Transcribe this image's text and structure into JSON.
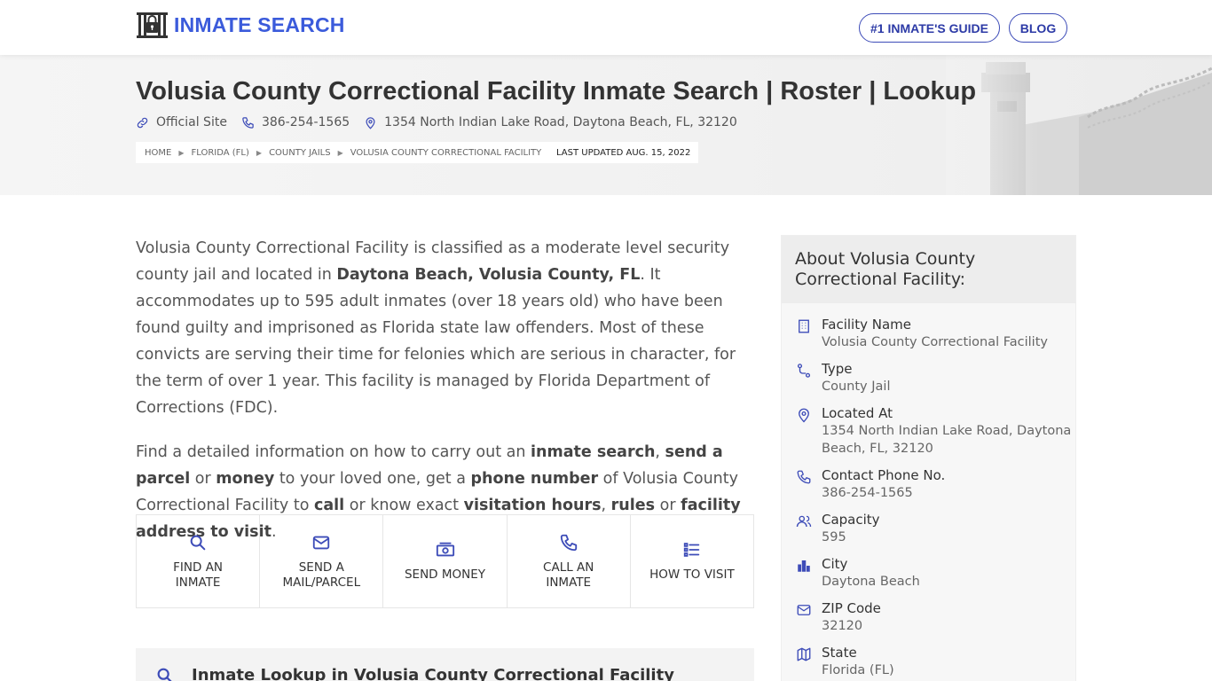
{
  "brand": {
    "name": "INMATE SEARCH",
    "logo_icon": "jail-cell-lock-icon",
    "color": "#3b5bdb"
  },
  "nav": {
    "guide_label": "#1 INMATE'S GUIDE",
    "blog_label": "BLOG"
  },
  "hero": {
    "title": "Volusia County Correctional Facility Inmate Search | Roster | Lookup",
    "official_site": "Official Site",
    "phone": "386-254-1565",
    "address": "1354 North Indian Lake Road, Daytona Beach, FL, 32120",
    "breadcrumbs": [
      "HOME",
      "FLORIDA (FL)",
      "COUNTY JAILS",
      "VOLUSIA COUNTY CORRECTIONAL FACILITY"
    ],
    "last_updated": "LAST UPDATED AUG. 15, 2022"
  },
  "intro": {
    "p1": {
      "t1": "Volusia County Correctional Facility is classified as a moderate level security county jail and located in ",
      "b1": "Daytona Beach, Volusia County, FL",
      "t2": ". It accommodates up to 595 adult inmates (over 18 years old) who have been found guilty and imprisoned as Florida state law offenders. Most of these convicts are serving their time for felonies which are serious in character, for the term of over 1 year. This facility is managed by Florida Department of Corrections (FDC)."
    },
    "p2": {
      "t1": "Find a detailed information on how to carry out an ",
      "b1": "inmate search",
      "t2": ", ",
      "b2": "send a parcel",
      "t3": " or ",
      "b3": "money",
      "t4": " to your loved one, get a ",
      "b4": "phone number",
      "t5": " of Volusia County Correctional Facility to ",
      "b5": "call",
      "t6": " or know exact ",
      "b6": "visitation hours",
      "t7": ", ",
      "b7": "rules",
      "t8": " or ",
      "b8": "facility address to visit",
      "t9": "."
    }
  },
  "actions": [
    {
      "label": "FIND AN INMATE",
      "icon": "search-icon"
    },
    {
      "label": "SEND A MAIL/PARCEL",
      "icon": "mail-icon"
    },
    {
      "label": "SEND MONEY",
      "icon": "money-icon"
    },
    {
      "label": "CALL AN INMATE",
      "icon": "phone-icon"
    },
    {
      "label": "HOW TO VISIT",
      "icon": "list-icon"
    }
  ],
  "lookup": {
    "title": "Inmate Lookup in Volusia County Correctional Facility"
  },
  "about": {
    "heading": "About Volusia County Correctional Facility:",
    "items": [
      {
        "label": "Facility Name",
        "value": "Volusia County Correctional Facility",
        "icon": "building-icon"
      },
      {
        "label": "Type",
        "value": "County Jail",
        "icon": "route-icon"
      },
      {
        "label": "Located At",
        "value": "1354 North Indian Lake Road, Daytona Beach, FL, 32120",
        "icon": "map-pin-icon"
      },
      {
        "label": "Contact Phone No.",
        "value": "386-254-1565",
        "icon": "phone-icon"
      },
      {
        "label": "Capacity",
        "value": "595",
        "icon": "users-icon"
      },
      {
        "label": "City",
        "value": "Daytona Beach",
        "icon": "city-icon"
      },
      {
        "label": "ZIP Code",
        "value": "32120",
        "icon": "mail-icon"
      },
      {
        "label": "State",
        "value": "Florida (FL)",
        "icon": "map-icon"
      }
    ]
  },
  "colors": {
    "accent": "#3b5bdb",
    "icon_blue": "#3d4cb8",
    "hero_bg": "#f2f2f2"
  }
}
